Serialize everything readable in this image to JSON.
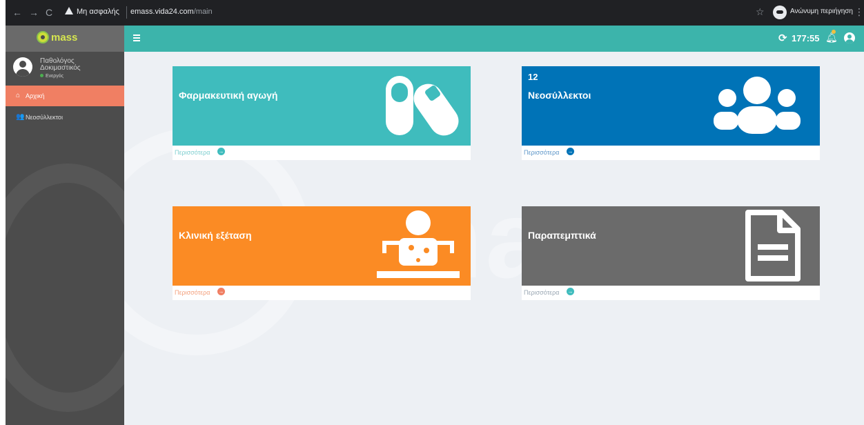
{
  "browser": {
    "security_label": "Μη ασφαλής",
    "url_host": "emass.vida24.com",
    "url_path": "/main",
    "incognito_label": "Ανώνυμη περιήγηση"
  },
  "brand": {
    "logo_text": "mass"
  },
  "user": {
    "name": "Παθολόγος Δοκιμαστικός",
    "status": "Ενεργός"
  },
  "sidebar": {
    "items": [
      {
        "label": "Αρχική",
        "icon": "home-icon",
        "active": true
      },
      {
        "label": "Νεοσύλλεκτοι",
        "icon": "users-icon",
        "active": false
      }
    ]
  },
  "header": {
    "timer": "177:55",
    "notification_badge_color": "#f0c040"
  },
  "cards": [
    {
      "title": "Φαρμακευτική αγωγή",
      "count": "",
      "more_label": "Περισσότερα",
      "color": "#3fbcbd",
      "icon": "pills-icon"
    },
    {
      "title": "Νεοσύλλεκτοι",
      "count": "12",
      "more_label": "Περισσότερα",
      "color": "#0073b7",
      "icon": "users-icon"
    },
    {
      "title": "Κλινική εξέταση",
      "count": "",
      "more_label": "Περισσότερα",
      "color": "#fb8b24",
      "icon": "user-injured-icon"
    },
    {
      "title": "Παραπεμπτικά",
      "count": "",
      "more_label": "Περισσότερα",
      "color": "#6b6b6b",
      "icon": "file-alt-icon"
    }
  ],
  "colors": {
    "topbar": "#3cb4ab",
    "sidebar": "#4c4c4c",
    "active_item": "#f07f63",
    "background": "#edf0f4"
  }
}
